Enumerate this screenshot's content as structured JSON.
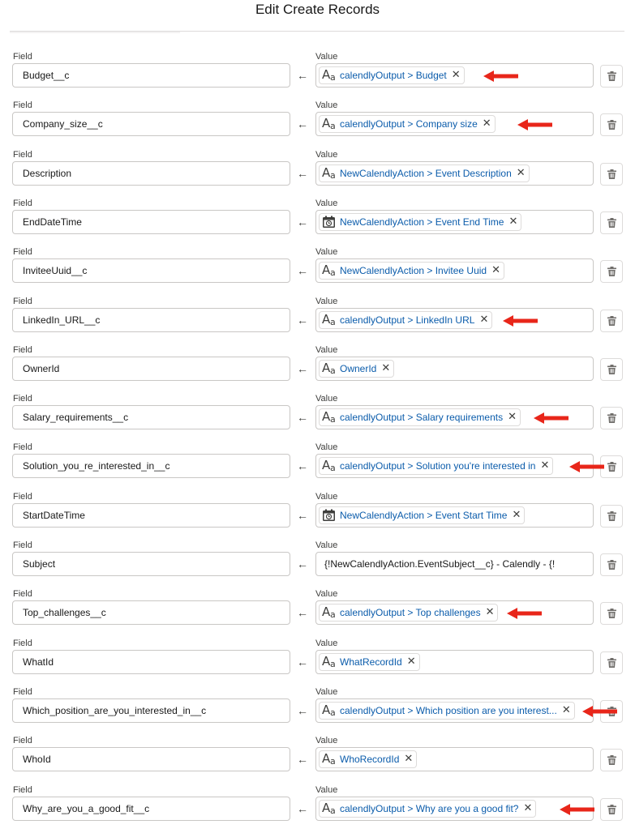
{
  "header": {
    "title": "Edit Create Records"
  },
  "labels": {
    "field": "Field",
    "value": "Value"
  },
  "icons": {
    "text_type": "text-type-icon",
    "date_type": "calendar-icon",
    "delete": "trash-icon",
    "remove": "close-icon",
    "mapping": "left-arrow-icon",
    "annotation": "red-arrow-annotation"
  },
  "colors": {
    "pill_text": "#0b5cab",
    "annotation": "#e8261a",
    "border": "#c9c7c5"
  },
  "rows": [
    {
      "field": "Budget__c",
      "value": "calendlyOutput > Budget",
      "type": "text",
      "highlighted": true
    },
    {
      "field": "Company_size__c",
      "value": "calendlyOutput > Company size",
      "type": "text",
      "highlighted": true
    },
    {
      "field": "Description",
      "value": "NewCalendlyAction > Event Description",
      "type": "text",
      "highlighted": false
    },
    {
      "field": "EndDateTime",
      "value": "NewCalendlyAction > Event End Time",
      "type": "date",
      "highlighted": false
    },
    {
      "field": "InviteeUuid__c",
      "value": "NewCalendlyAction > Invitee Uuid",
      "type": "text",
      "highlighted": false
    },
    {
      "field": "LinkedIn_URL__c",
      "value": "calendlyOutput > LinkedIn URL",
      "type": "text",
      "highlighted": true
    },
    {
      "field": "OwnerId",
      "value": "OwnerId",
      "type": "text",
      "highlighted": false
    },
    {
      "field": "Salary_requirements__c",
      "value": "calendlyOutput > Salary requirements",
      "type": "text",
      "highlighted": true
    },
    {
      "field": "Solution_you_re_interested_in__c",
      "value": "calendlyOutput > Solution you're interested in",
      "type": "text",
      "highlighted": true
    },
    {
      "field": "StartDateTime",
      "value": "NewCalendlyAction > Event Start Time",
      "type": "date",
      "highlighted": false
    },
    {
      "field": "Subject",
      "value": "{!NewCalendlyAction.EventSubject__c} - Calendly - {!",
      "type": "plain",
      "highlighted": false
    },
    {
      "field": "Top_challenges__c",
      "value": "calendlyOutput > Top challenges",
      "type": "text",
      "highlighted": true
    },
    {
      "field": "WhatId",
      "value": "WhatRecordId",
      "type": "text",
      "highlighted": false
    },
    {
      "field": "Which_position_are_you_interested_in__c",
      "value": "calendlyOutput > Which position are you interest...",
      "type": "text",
      "highlighted": true
    },
    {
      "field": "WhoId",
      "value": "WhoRecordId",
      "type": "text",
      "highlighted": false
    },
    {
      "field": "Why_are_you_a_good_fit__c",
      "value": "calendlyOutput > Why are you a good fit?",
      "type": "text",
      "highlighted": true
    }
  ]
}
